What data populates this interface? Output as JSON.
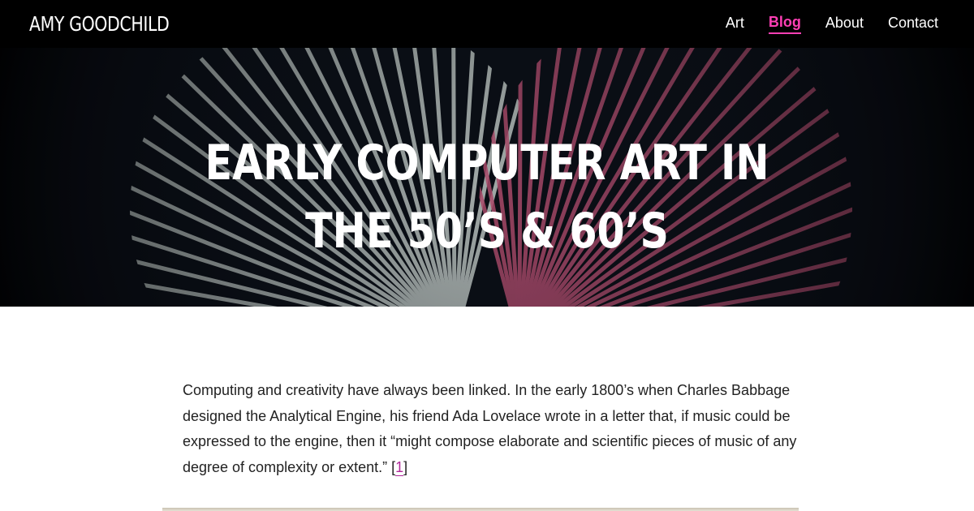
{
  "site": {
    "brand": "AMY GOODCHILD"
  },
  "nav": {
    "items": [
      {
        "label": "Art",
        "active": false
      },
      {
        "label": "Blog",
        "active": true
      },
      {
        "label": "About",
        "active": false
      },
      {
        "label": "Contact",
        "active": false
      }
    ]
  },
  "hero": {
    "title": "EARLY COMPUTER ART IN THE 50’S & 60’S"
  },
  "article": {
    "paragraph1": "Computing and creativity have always been linked. In the early 1800’s when Charles Babbage designed the Analytical Engine, his friend Ada Lovelace wrote in a letter that, if music could be expressed to the engine, then it “might compose elaborate and scientific pieces of music of any degree of complexity or extent.” ",
    "citation_open": "[",
    "citation_number": "1",
    "citation_close": "]"
  },
  "colors": {
    "accent": "#ff3fb5",
    "topbar": "#000000",
    "citation_link": "#b0289a"
  }
}
